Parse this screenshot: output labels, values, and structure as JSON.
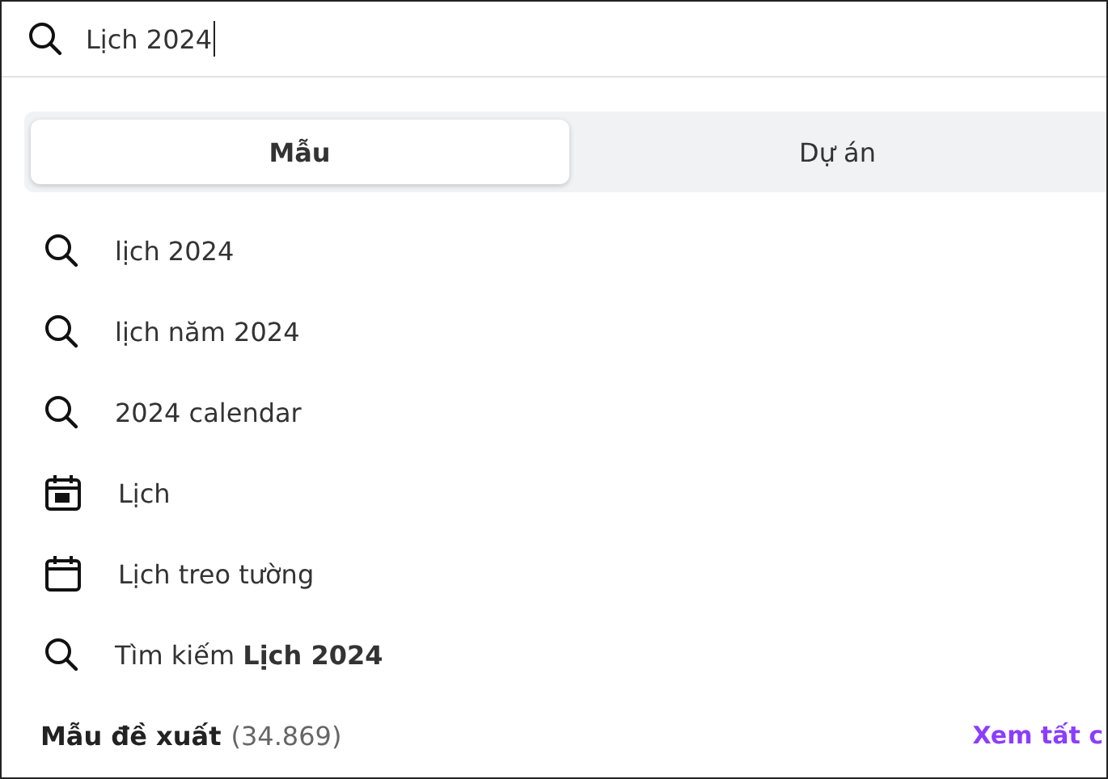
{
  "search": {
    "value": "Lịch 2024"
  },
  "tabs": [
    {
      "label": "Mẫu",
      "selected": true
    },
    {
      "label": "Dự án",
      "selected": false
    }
  ],
  "suggestions": [
    {
      "kind": "search",
      "label": "lịch 2024"
    },
    {
      "kind": "search",
      "label": "lịch năm 2024"
    },
    {
      "kind": "search",
      "label": "2024 calendar"
    },
    {
      "kind": "calendar-date",
      "label": "Lịch"
    },
    {
      "kind": "calendar",
      "label": "Lịch treo tường"
    },
    {
      "kind": "search",
      "label": "Tìm kiếm **Lịch 2024**"
    }
  ],
  "footer": {
    "title": "Mẫu đề xuất",
    "count": "(34.869)",
    "link": "Xem tất c"
  }
}
